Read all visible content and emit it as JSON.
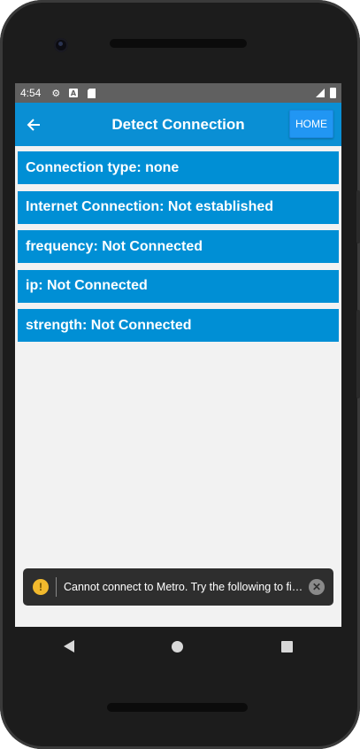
{
  "status_bar": {
    "time": "4:54",
    "icons": [
      "gear-icon",
      "a-icon",
      "sd-card-icon"
    ],
    "right_icons": [
      "signal-icon",
      "battery-icon"
    ]
  },
  "app_bar": {
    "back_icon": "arrow-left-icon",
    "title": "Detect Connection",
    "home_label": "HOME",
    "color": "#0a8fd4"
  },
  "connection_items": [
    {
      "label": "Connection type: none"
    },
    {
      "label": "Internet Connection: Not established"
    },
    {
      "label": "frequency: Not Connected"
    },
    {
      "label": "ip: Not Connected"
    },
    {
      "label": "strength: Not Connected"
    }
  ],
  "toast": {
    "icon": "warning-icon",
    "message": "Cannot connect to Metro.  Try the following to fix the issue: - Ensure that the Metro server is running",
    "close_icon": "close-icon"
  },
  "nav_bar": {
    "buttons": [
      "back",
      "home",
      "recents"
    ]
  }
}
